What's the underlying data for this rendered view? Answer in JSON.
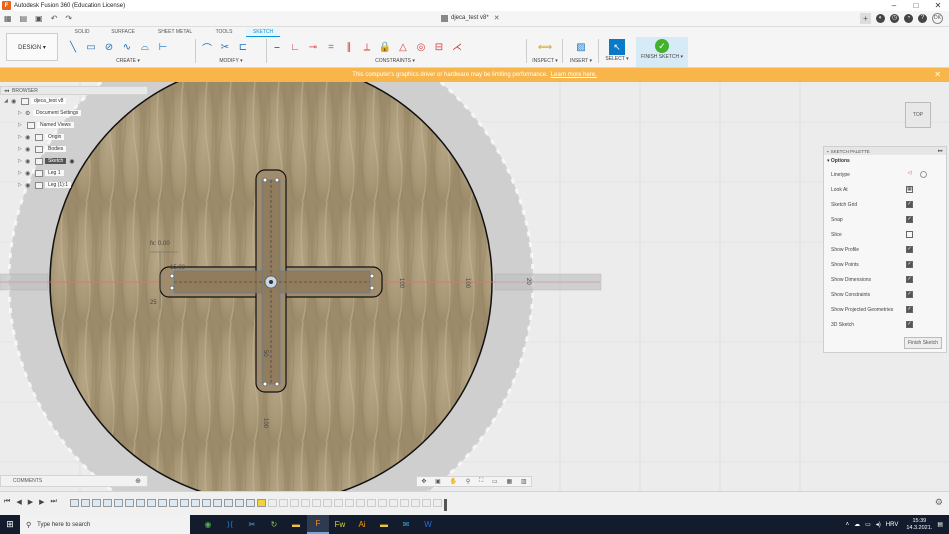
{
  "window": {
    "title": "Autodesk Fusion 360 (Education License)",
    "controls": [
      "–",
      "□",
      "✕"
    ]
  },
  "document": {
    "name": "djeca_test v8*"
  },
  "ribbon": {
    "workspace": "DESIGN ▾",
    "tabs": [
      "SOLID",
      "SURFACE",
      "SHEET METAL",
      "TOOLS",
      "SKETCH"
    ],
    "active_tab": "SKETCH",
    "groups": {
      "create": "CREATE ▾",
      "modify": "MODIFY ▾",
      "constraints": "CONSTRAINTS ▾",
      "inspect": "INSPECT ▾",
      "insert": "INSERT ▾",
      "select": "SELECT ▾",
      "finish": "FINISH SKETCH ▾"
    }
  },
  "banner": {
    "text": "This computer's graphics driver or hardware may be limiting performance.",
    "link": "Learn more here."
  },
  "browser": {
    "title": "BROWSER",
    "items": [
      {
        "label": "djeca_test v8",
        "level": 0
      },
      {
        "label": "Document Settings",
        "level": 1
      },
      {
        "label": "Named Views",
        "level": 1
      },
      {
        "label": "Origin",
        "level": 1
      },
      {
        "label": "Bodies",
        "level": 1
      },
      {
        "label": "Sketch",
        "level": 1
      },
      {
        "label": "Leg 1",
        "level": 1
      },
      {
        "label": "Leg (1):1",
        "level": 1
      }
    ]
  },
  "viewcube": {
    "face": "TOP"
  },
  "sketch_palette": {
    "title": "SKETCH PALETTE",
    "section": "Options",
    "options": [
      {
        "label": "Linetype",
        "checked": null
      },
      {
        "label": "Look At",
        "checked": null
      },
      {
        "label": "Sketch Grid",
        "checked": true
      },
      {
        "label": "Snap",
        "checked": true
      },
      {
        "label": "Slice",
        "checked": false
      },
      {
        "label": "Show Profile",
        "checked": true
      },
      {
        "label": "Show Points",
        "checked": true
      },
      {
        "label": "Show Dimensions",
        "checked": true
      },
      {
        "label": "Show Constraints",
        "checked": true
      },
      {
        "label": "Show Projected Geometries",
        "checked": true
      },
      {
        "label": "3D Sketch",
        "checked": true
      }
    ],
    "finish_button": "Finish Sketch"
  },
  "dimensions": {
    "d1": "100",
    "d2": "100",
    "d3": "20",
    "d4": "50",
    "d5": "100",
    "d6": "fx: 0.00",
    "d7": "15.00",
    "d8": "25"
  },
  "comments": {
    "label": "COMMENTS"
  },
  "taskbar": {
    "search_placeholder": "Type here to search",
    "language": "HRV",
    "time": "15:39",
    "date": "14.3.2021."
  },
  "colors": {
    "accent": "#0696d7",
    "banner": "#f8b54a",
    "finish_check": "#43b12e",
    "taskbar": "#121c2c"
  }
}
